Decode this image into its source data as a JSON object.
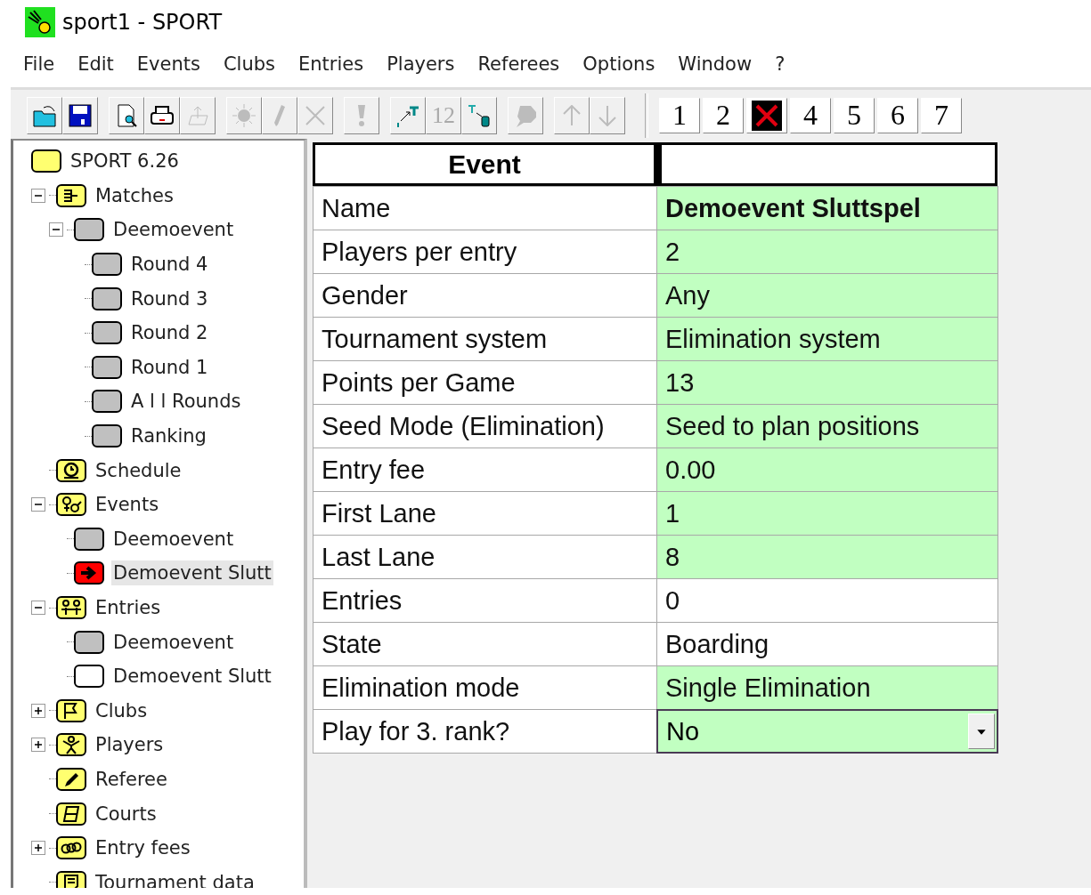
{
  "window": {
    "title": "sport1 - SPORT"
  },
  "menu": [
    "File",
    "Edit",
    "Events",
    "Clubs",
    "Entries",
    "Players",
    "Referees",
    "Options",
    "Window",
    "?"
  ],
  "toolbar": [
    [
      {
        "kind": "open",
        "disabled": false
      },
      {
        "kind": "save",
        "disabled": false
      }
    ],
    [
      {
        "kind": "preview",
        "disabled": false
      },
      {
        "kind": "print",
        "disabled": false
      },
      {
        "kind": "export",
        "disabled": true
      }
    ],
    [
      {
        "kind": "sun",
        "disabled": true
      },
      {
        "kind": "pen",
        "disabled": true
      },
      {
        "kind": "delete",
        "disabled": true
      }
    ],
    [
      {
        "kind": "alert",
        "disabled": true
      }
    ],
    [
      {
        "kind": "textlink",
        "disabled": false
      },
      {
        "kind": "number",
        "label": "12",
        "disabled": true
      },
      {
        "kind": "textmove",
        "disabled": false
      }
    ],
    [
      {
        "kind": "bubble",
        "disabled": true
      }
    ],
    [
      {
        "kind": "up",
        "disabled": true
      },
      {
        "kind": "down",
        "disabled": true
      }
    ]
  ],
  "window_buttons": [
    {
      "kind": "digit",
      "label": "1"
    },
    {
      "kind": "digit",
      "label": "2"
    },
    {
      "kind": "cross"
    },
    {
      "kind": "digit",
      "label": "4"
    },
    {
      "kind": "digit",
      "label": "5"
    },
    {
      "kind": "digit",
      "label": "6"
    },
    {
      "kind": "digit",
      "label": "7"
    }
  ],
  "tree": [
    {
      "label": "SPORT 6.26",
      "kind": "root",
      "selected": false,
      "children": [
        {
          "label": "Matches",
          "kind": "matches",
          "expanded": true,
          "selected": false,
          "children": [
            {
              "label": "Deemoevent",
              "kind": "grey",
              "expanded": true,
              "selected": false,
              "children": [
                {
                  "label": "Round 4",
                  "kind": "grey",
                  "selected": false
                },
                {
                  "label": "Round 3",
                  "kind": "grey",
                  "selected": false
                },
                {
                  "label": "Round 2",
                  "kind": "grey",
                  "selected": false
                },
                {
                  "label": "Round 1",
                  "kind": "grey",
                  "selected": false
                },
                {
                  "label": "A l l Rounds",
                  "kind": "grey",
                  "selected": false
                },
                {
                  "label": "Ranking",
                  "kind": "grey",
                  "selected": false
                }
              ]
            }
          ]
        },
        {
          "label": "Schedule",
          "kind": "schedule",
          "selected": false
        },
        {
          "label": "Events",
          "kind": "events",
          "expanded": true,
          "selected": false,
          "children": [
            {
              "label": "Deemoevent",
              "kind": "grey",
              "selected": false
            },
            {
              "label": "Demoevent Slutt",
              "kind": "arrow",
              "selected": true
            }
          ]
        },
        {
          "label": "Entries",
          "kind": "entries",
          "expanded": true,
          "selected": false,
          "children": [
            {
              "label": "Deemoevent",
              "kind": "grey",
              "selected": false
            },
            {
              "label": "Demoevent Slutt",
              "kind": "white",
              "selected": false
            }
          ]
        },
        {
          "label": "Clubs",
          "kind": "clubs",
          "expanded": false,
          "selected": false
        },
        {
          "label": "Players",
          "kind": "players",
          "expanded": false,
          "selected": false
        },
        {
          "label": "Referee",
          "kind": "referee",
          "selected": false
        },
        {
          "label": "Courts",
          "kind": "courts",
          "selected": false
        },
        {
          "label": "Entry fees",
          "kind": "fees",
          "expanded": false,
          "selected": false
        },
        {
          "label": "Tournament data",
          "kind": "data",
          "selected": false
        }
      ]
    }
  ],
  "table": {
    "columns": [
      "Event"
    ],
    "rows": [
      {
        "label": "Name",
        "value": "Demoevent Sluttspel",
        "kind": "text",
        "editable": true,
        "bold": true
      },
      {
        "label": "Players per entry",
        "value": "2",
        "kind": "text",
        "editable": true,
        "bold": false
      },
      {
        "label": "Gender",
        "value": "Any",
        "kind": "text",
        "editable": true,
        "bold": false
      },
      {
        "label": "Tournament system",
        "value": "Elimination system",
        "kind": "text",
        "editable": true,
        "bold": false
      },
      {
        "label": "Points per Game",
        "value": "13",
        "kind": "text",
        "editable": true,
        "bold": false
      },
      {
        "label": "Seed Mode (Elimination)",
        "value": "Seed to plan positions",
        "kind": "text",
        "editable": true,
        "bold": false
      },
      {
        "label": "Entry fee",
        "value": "0.00",
        "kind": "text",
        "editable": true,
        "bold": false
      },
      {
        "label": "First Lane",
        "value": "1",
        "kind": "text",
        "editable": true,
        "bold": false
      },
      {
        "label": "Last Lane",
        "value": "8",
        "kind": "text",
        "editable": true,
        "bold": false
      },
      {
        "label": "Entries",
        "value": "0",
        "kind": "text",
        "editable": false,
        "bold": false
      },
      {
        "label": "State",
        "value": "Boarding",
        "kind": "text",
        "editable": false,
        "bold": false
      },
      {
        "label": "Elimination mode",
        "value": "Single Elimination",
        "kind": "text",
        "editable": true,
        "bold": false
      },
      {
        "label": "Play for 3. rank?",
        "value": "No",
        "kind": "dropdown",
        "editable": true,
        "bold": false
      }
    ]
  }
}
